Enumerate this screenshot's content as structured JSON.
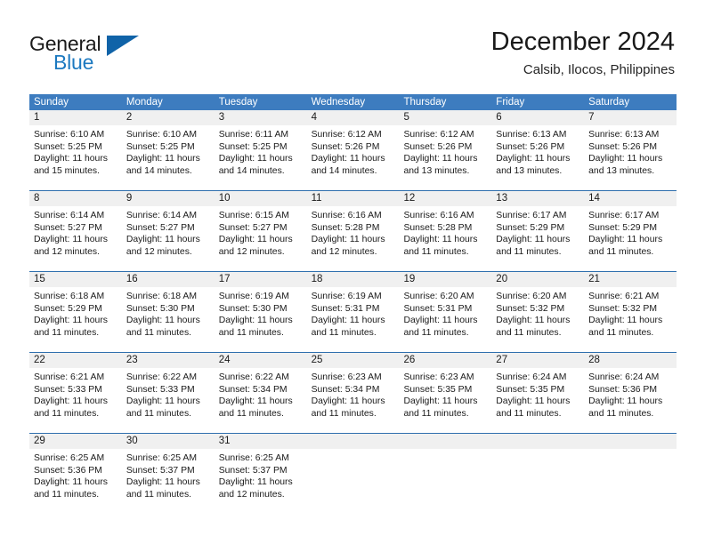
{
  "brand": {
    "name_top": "General",
    "name_bottom": "Blue",
    "triangle_color": "#1063a8",
    "blue_text_color": "#1c79c0"
  },
  "header": {
    "title": "December 2024",
    "location": "Calsib, Ilocos, Philippines"
  },
  "theme": {
    "header_blue": "#3d7cbf",
    "row_divider_blue": "#2f6fae",
    "day_band_gray": "#f0f0f0"
  },
  "weekdays": [
    "Sunday",
    "Monday",
    "Tuesday",
    "Wednesday",
    "Thursday",
    "Friday",
    "Saturday"
  ],
  "weeks": [
    [
      {
        "day": "1",
        "sunrise": "Sunrise: 6:10 AM",
        "sunset": "Sunset: 5:25 PM",
        "daylight1": "Daylight: 11 hours",
        "daylight2": "and 15 minutes."
      },
      {
        "day": "2",
        "sunrise": "Sunrise: 6:10 AM",
        "sunset": "Sunset: 5:25 PM",
        "daylight1": "Daylight: 11 hours",
        "daylight2": "and 14 minutes."
      },
      {
        "day": "3",
        "sunrise": "Sunrise: 6:11 AM",
        "sunset": "Sunset: 5:25 PM",
        "daylight1": "Daylight: 11 hours",
        "daylight2": "and 14 minutes."
      },
      {
        "day": "4",
        "sunrise": "Sunrise: 6:12 AM",
        "sunset": "Sunset: 5:26 PM",
        "daylight1": "Daylight: 11 hours",
        "daylight2": "and 14 minutes."
      },
      {
        "day": "5",
        "sunrise": "Sunrise: 6:12 AM",
        "sunset": "Sunset: 5:26 PM",
        "daylight1": "Daylight: 11 hours",
        "daylight2": "and 13 minutes."
      },
      {
        "day": "6",
        "sunrise": "Sunrise: 6:13 AM",
        "sunset": "Sunset: 5:26 PM",
        "daylight1": "Daylight: 11 hours",
        "daylight2": "and 13 minutes."
      },
      {
        "day": "7",
        "sunrise": "Sunrise: 6:13 AM",
        "sunset": "Sunset: 5:26 PM",
        "daylight1": "Daylight: 11 hours",
        "daylight2": "and 13 minutes."
      }
    ],
    [
      {
        "day": "8",
        "sunrise": "Sunrise: 6:14 AM",
        "sunset": "Sunset: 5:27 PM",
        "daylight1": "Daylight: 11 hours",
        "daylight2": "and 12 minutes."
      },
      {
        "day": "9",
        "sunrise": "Sunrise: 6:14 AM",
        "sunset": "Sunset: 5:27 PM",
        "daylight1": "Daylight: 11 hours",
        "daylight2": "and 12 minutes."
      },
      {
        "day": "10",
        "sunrise": "Sunrise: 6:15 AM",
        "sunset": "Sunset: 5:27 PM",
        "daylight1": "Daylight: 11 hours",
        "daylight2": "and 12 minutes."
      },
      {
        "day": "11",
        "sunrise": "Sunrise: 6:16 AM",
        "sunset": "Sunset: 5:28 PM",
        "daylight1": "Daylight: 11 hours",
        "daylight2": "and 12 minutes."
      },
      {
        "day": "12",
        "sunrise": "Sunrise: 6:16 AM",
        "sunset": "Sunset: 5:28 PM",
        "daylight1": "Daylight: 11 hours",
        "daylight2": "and 11 minutes."
      },
      {
        "day": "13",
        "sunrise": "Sunrise: 6:17 AM",
        "sunset": "Sunset: 5:29 PM",
        "daylight1": "Daylight: 11 hours",
        "daylight2": "and 11 minutes."
      },
      {
        "day": "14",
        "sunrise": "Sunrise: 6:17 AM",
        "sunset": "Sunset: 5:29 PM",
        "daylight1": "Daylight: 11 hours",
        "daylight2": "and 11 minutes."
      }
    ],
    [
      {
        "day": "15",
        "sunrise": "Sunrise: 6:18 AM",
        "sunset": "Sunset: 5:29 PM",
        "daylight1": "Daylight: 11 hours",
        "daylight2": "and 11 minutes."
      },
      {
        "day": "16",
        "sunrise": "Sunrise: 6:18 AM",
        "sunset": "Sunset: 5:30 PM",
        "daylight1": "Daylight: 11 hours",
        "daylight2": "and 11 minutes."
      },
      {
        "day": "17",
        "sunrise": "Sunrise: 6:19 AM",
        "sunset": "Sunset: 5:30 PM",
        "daylight1": "Daylight: 11 hours",
        "daylight2": "and 11 minutes."
      },
      {
        "day": "18",
        "sunrise": "Sunrise: 6:19 AM",
        "sunset": "Sunset: 5:31 PM",
        "daylight1": "Daylight: 11 hours",
        "daylight2": "and 11 minutes."
      },
      {
        "day": "19",
        "sunrise": "Sunrise: 6:20 AM",
        "sunset": "Sunset: 5:31 PM",
        "daylight1": "Daylight: 11 hours",
        "daylight2": "and 11 minutes."
      },
      {
        "day": "20",
        "sunrise": "Sunrise: 6:20 AM",
        "sunset": "Sunset: 5:32 PM",
        "daylight1": "Daylight: 11 hours",
        "daylight2": "and 11 minutes."
      },
      {
        "day": "21",
        "sunrise": "Sunrise: 6:21 AM",
        "sunset": "Sunset: 5:32 PM",
        "daylight1": "Daylight: 11 hours",
        "daylight2": "and 11 minutes."
      }
    ],
    [
      {
        "day": "22",
        "sunrise": "Sunrise: 6:21 AM",
        "sunset": "Sunset: 5:33 PM",
        "daylight1": "Daylight: 11 hours",
        "daylight2": "and 11 minutes."
      },
      {
        "day": "23",
        "sunrise": "Sunrise: 6:22 AM",
        "sunset": "Sunset: 5:33 PM",
        "daylight1": "Daylight: 11 hours",
        "daylight2": "and 11 minutes."
      },
      {
        "day": "24",
        "sunrise": "Sunrise: 6:22 AM",
        "sunset": "Sunset: 5:34 PM",
        "daylight1": "Daylight: 11 hours",
        "daylight2": "and 11 minutes."
      },
      {
        "day": "25",
        "sunrise": "Sunrise: 6:23 AM",
        "sunset": "Sunset: 5:34 PM",
        "daylight1": "Daylight: 11 hours",
        "daylight2": "and 11 minutes."
      },
      {
        "day": "26",
        "sunrise": "Sunrise: 6:23 AM",
        "sunset": "Sunset: 5:35 PM",
        "daylight1": "Daylight: 11 hours",
        "daylight2": "and 11 minutes."
      },
      {
        "day": "27",
        "sunrise": "Sunrise: 6:24 AM",
        "sunset": "Sunset: 5:35 PM",
        "daylight1": "Daylight: 11 hours",
        "daylight2": "and 11 minutes."
      },
      {
        "day": "28",
        "sunrise": "Sunrise: 6:24 AM",
        "sunset": "Sunset: 5:36 PM",
        "daylight1": "Daylight: 11 hours",
        "daylight2": "and 11 minutes."
      }
    ],
    [
      {
        "day": "29",
        "sunrise": "Sunrise: 6:25 AM",
        "sunset": "Sunset: 5:36 PM",
        "daylight1": "Daylight: 11 hours",
        "daylight2": "and 11 minutes."
      },
      {
        "day": "30",
        "sunrise": "Sunrise: 6:25 AM",
        "sunset": "Sunset: 5:37 PM",
        "daylight1": "Daylight: 11 hours",
        "daylight2": "and 11 minutes."
      },
      {
        "day": "31",
        "sunrise": "Sunrise: 6:25 AM",
        "sunset": "Sunset: 5:37 PM",
        "daylight1": "Daylight: 11 hours",
        "daylight2": "and 12 minutes."
      },
      {
        "day": "",
        "sunrise": "",
        "sunset": "",
        "daylight1": "",
        "daylight2": ""
      },
      {
        "day": "",
        "sunrise": "",
        "sunset": "",
        "daylight1": "",
        "daylight2": ""
      },
      {
        "day": "",
        "sunrise": "",
        "sunset": "",
        "daylight1": "",
        "daylight2": ""
      },
      {
        "day": "",
        "sunrise": "",
        "sunset": "",
        "daylight1": "",
        "daylight2": ""
      }
    ]
  ]
}
